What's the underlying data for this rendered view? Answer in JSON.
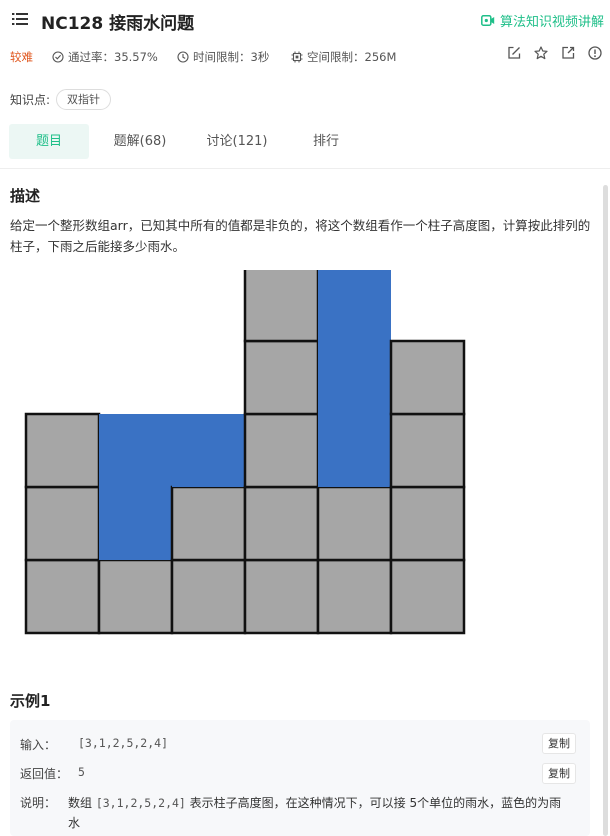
{
  "header": {
    "title": "NC128  接雨水问题",
    "video_link": "算法知识视频讲解"
  },
  "meta": {
    "difficulty": "较难",
    "pass_rate": "通过率：35.57%",
    "time_limit": "时间限制：3秒",
    "memory_limit": "空间限制：256M"
  },
  "knowledge": {
    "label": "知识点:",
    "tags": [
      "双指针"
    ]
  },
  "tabs": [
    {
      "label": "题目",
      "active": true
    },
    {
      "label": "题解(68)",
      "active": false
    },
    {
      "label": "讨论(121)",
      "active": false
    },
    {
      "label": "排行",
      "active": false
    }
  ],
  "description": {
    "heading": "描述",
    "text": "给定一个整形数组arr，已知其中所有的值都是非负的，将这个数组看作一个柱子高度图，计算按此排列的柱子，下雨之后能接多少雨水。"
  },
  "diagram": {
    "heights": [
      3,
      1,
      2,
      5,
      2,
      4
    ],
    "water": [
      0,
      2,
      1,
      0,
      3,
      0
    ],
    "bar_color": "#a6a6a6",
    "water_color": "#3a72c4"
  },
  "example": {
    "heading": "示例1",
    "input_label": "输入：",
    "input_value": "[3,1,2,5,2,4]",
    "output_label": "返回值：",
    "output_value": "5",
    "copy_label": "复制",
    "explain_label": "说明：",
    "explain_pre": "数组 ",
    "explain_code": "[3,1,2,5,2,4]",
    "explain_post": " 表示柱子高度图，在这种情况下，可以接  5个单位的雨水，蓝色的为雨水"
  },
  "colors": {
    "accent": "#1fbf89",
    "difficulty": "#e0561d"
  }
}
